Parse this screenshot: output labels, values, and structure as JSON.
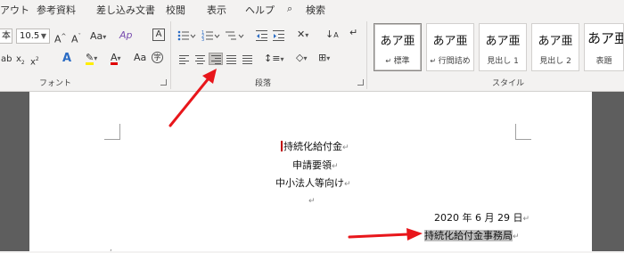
{
  "menu": [
    "アウト",
    "参考資料",
    "差し込み文書",
    "校閲",
    "表示",
    "ヘルプ",
    "検索"
  ],
  "font_group": {
    "font_name_partial": "本",
    "font_size": "10.5",
    "label": "フォント"
  },
  "paragraph_group": {
    "label": "段落"
  },
  "styles_group": {
    "label": "スタイル",
    "cards": [
      {
        "sample": "あア亜",
        "name": "標準"
      },
      {
        "sample": "あア亜",
        "name": "行間詰め"
      },
      {
        "sample": "あア亜",
        "name": "見出し 1"
      },
      {
        "sample": "あア亜",
        "name": "見出し 2"
      },
      {
        "sample": "あア亜",
        "name": "表題"
      }
    ]
  },
  "document": {
    "lines": [
      "持続化給付金",
      "申請要領",
      "中小法人等向け"
    ],
    "date": "2020 年 6 月 29 日",
    "sender": "持続化給付金事務局"
  },
  "colors": {
    "arrow": "#e8161b",
    "highlight": "#c00000",
    "active_button": "#c8c6c4"
  }
}
